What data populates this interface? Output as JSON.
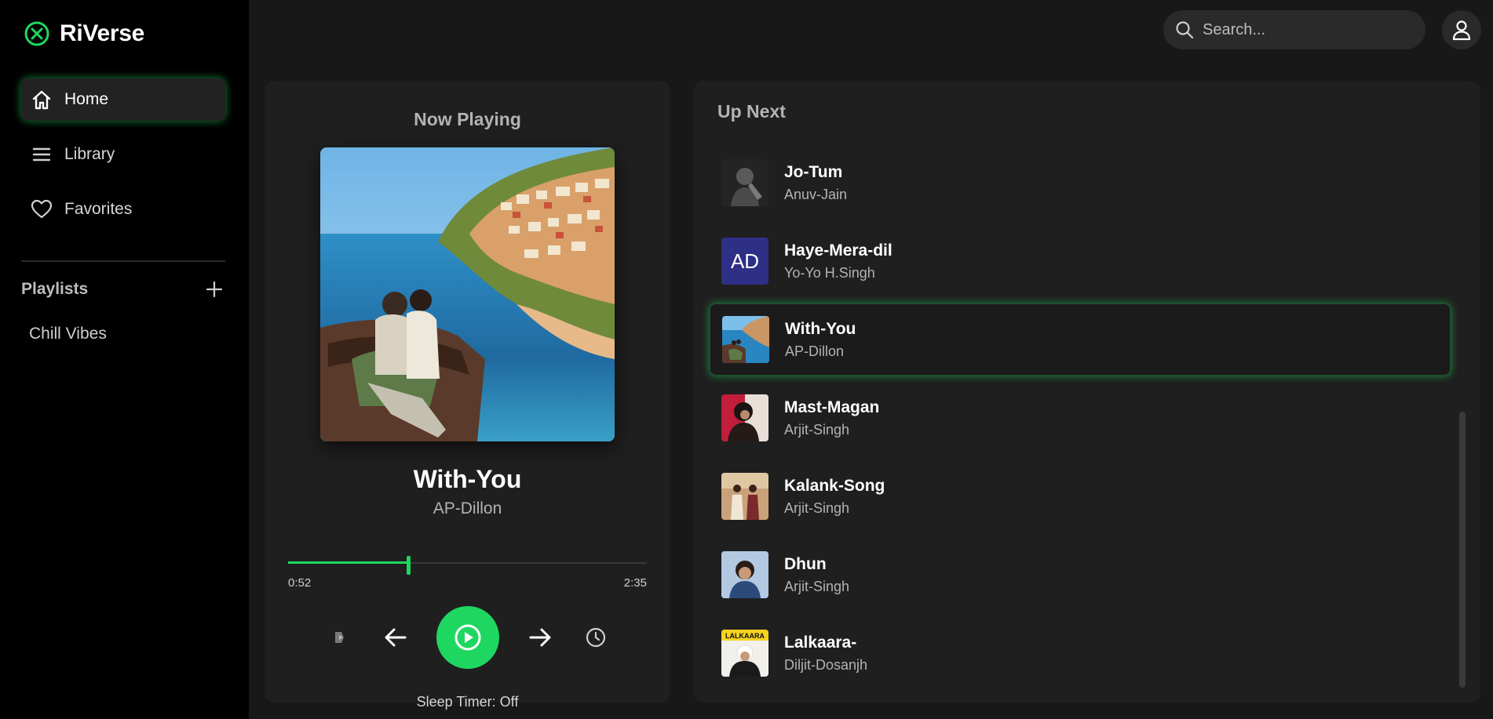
{
  "app": {
    "name": "RiVerse",
    "accent": "#1ed760"
  },
  "sidebar": {
    "items": [
      {
        "label": "Home",
        "icon": "home-icon",
        "active": true
      },
      {
        "label": "Library",
        "icon": "menu-icon",
        "active": false
      },
      {
        "label": "Favorites",
        "icon": "heart-icon",
        "active": false
      }
    ],
    "playlists_title": "Playlists",
    "playlists": [
      "Chill Vibes"
    ]
  },
  "header": {
    "search_placeholder": "Search..."
  },
  "now_playing": {
    "heading": "Now Playing",
    "title": "With-You",
    "artist": "AP-Dillon",
    "current_time": "0:52",
    "total_time": "2:35",
    "progress": 0.335,
    "sleep_timer": "Sleep Timer: Off"
  },
  "up_next": {
    "heading": "Up Next",
    "items": [
      {
        "title": "Jo-Tum",
        "artist": "Anuv-Jain",
        "thumb": "photo-dark"
      },
      {
        "title": "Haye-Mera-dil",
        "artist": "Yo-Yo H.Singh",
        "thumb": "initials",
        "initials": "AD"
      },
      {
        "title": "With-You",
        "artist": "AP-Dillon",
        "thumb": "photo-coast",
        "active": true
      },
      {
        "title": "Mast-Magan",
        "artist": "Arjit-Singh",
        "thumb": "photo-red"
      },
      {
        "title": "Kalank-Song",
        "artist": "Arjit-Singh",
        "thumb": "photo-warm"
      },
      {
        "title": "Dhun",
        "artist": "Arjit-Singh",
        "thumb": "photo-blue"
      },
      {
        "title": "Lalkaara-",
        "artist": "Diljit-Dosanjh",
        "thumb": "photo-yellow",
        "thumb_text": "LALKAARA"
      }
    ]
  }
}
